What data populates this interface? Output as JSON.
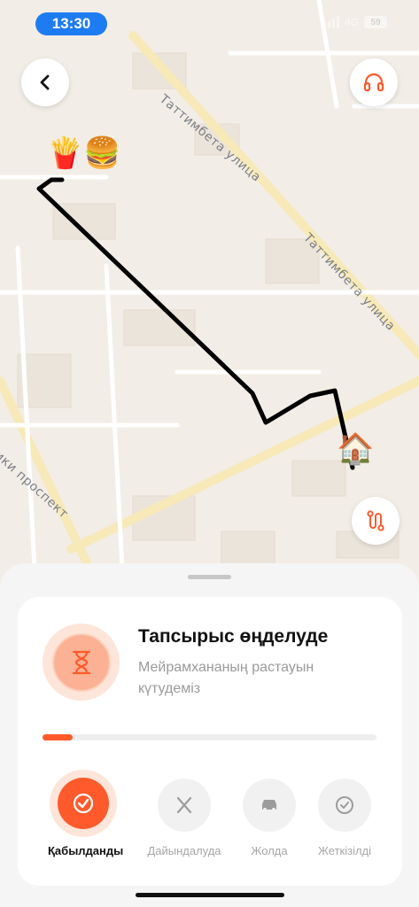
{
  "status_bar": {
    "time": "13:30",
    "network": "4G",
    "battery": "59"
  },
  "map": {
    "streets": [
      "Таттимбета улица",
      "Таттимбета улица",
      "ики проспект"
    ],
    "restaurant_marker": "🍟🍔",
    "home_marker": "🏠",
    "route_color": "#000000"
  },
  "buttons": {
    "back_icon": "chevron-left-icon",
    "support_icon": "headphones-icon",
    "route_icon": "route-icon"
  },
  "order": {
    "title": "Тапсырыс өңделуде",
    "subtitle": "Мейрамхананың растауын күтудеміз",
    "progress": 0.09,
    "accent": "#ff5a2b"
  },
  "steps": [
    {
      "label": "Қабылданды",
      "icon": "check-icon",
      "active": true
    },
    {
      "label": "Дайындалуда",
      "icon": "fork-knife-icon",
      "active": false
    },
    {
      "label": "Жолда",
      "icon": "car-icon",
      "active": false
    },
    {
      "label": "Жеткізілді",
      "icon": "check-circle-icon",
      "active": false
    }
  ]
}
